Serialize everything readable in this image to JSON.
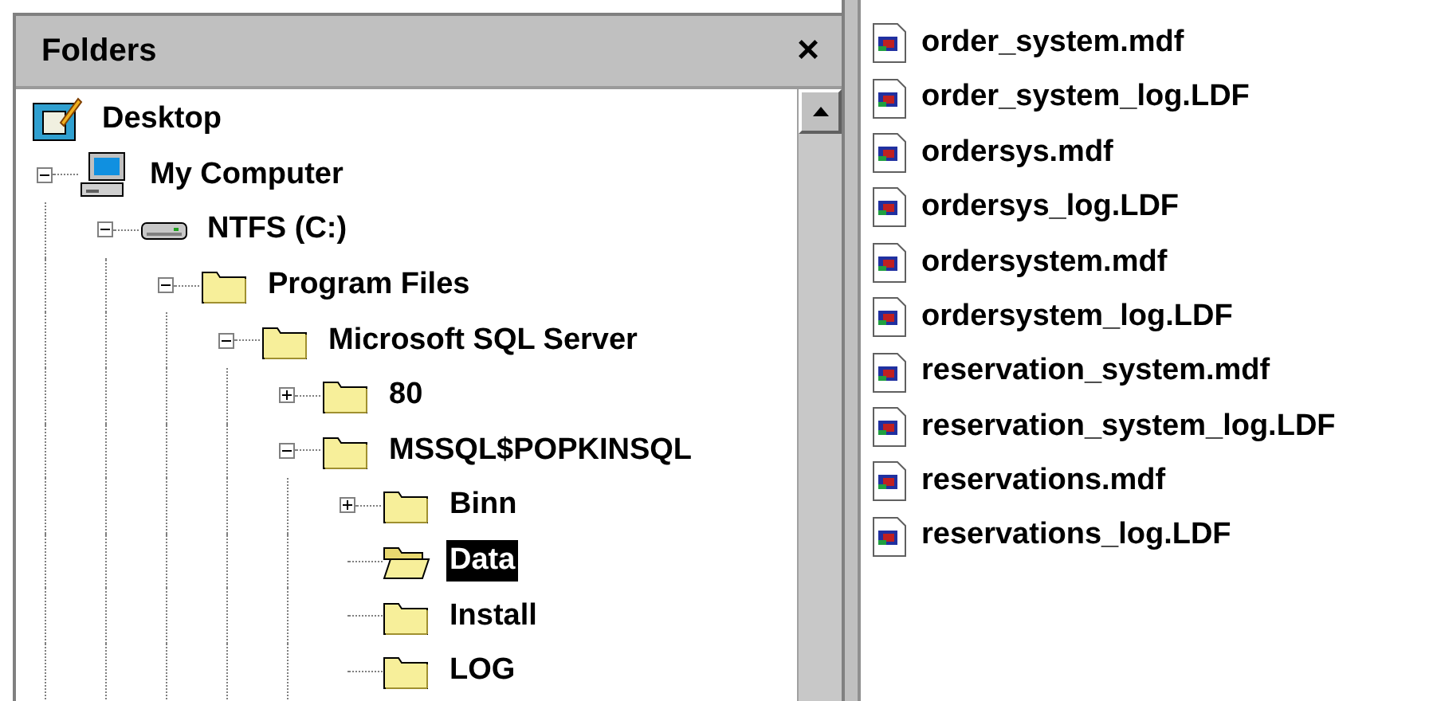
{
  "folders_pane": {
    "title": "Folders",
    "close": "×"
  },
  "tree": [
    {
      "label": "Desktop",
      "kind": "desktop",
      "selected": false,
      "children": [
        {
          "label": "My Computer",
          "kind": "computer",
          "expanded": true,
          "selected": false,
          "children": [
            {
              "label": "NTFS (C:)",
              "kind": "drive",
              "expanded": true,
              "selected": false,
              "children": [
                {
                  "label": "Program Files",
                  "kind": "folder",
                  "expanded": true,
                  "selected": false,
                  "children": [
                    {
                      "label": "Microsoft SQL Server",
                      "kind": "folder",
                      "expanded": true,
                      "selected": false,
                      "children": [
                        {
                          "label": "80",
                          "kind": "folder",
                          "expanded": false,
                          "selected": false
                        },
                        {
                          "label": "MSSQL$POPKINSQL",
                          "kind": "folder",
                          "expanded": true,
                          "selected": false,
                          "children": [
                            {
                              "label": "Binn",
                              "kind": "folder",
                              "expanded": false,
                              "selected": false
                            },
                            {
                              "label": "Data",
                              "kind": "folder",
                              "selected": true
                            },
                            {
                              "label": "Install",
                              "kind": "folder",
                              "selected": false
                            },
                            {
                              "label": "LOG",
                              "kind": "folder",
                              "selected": false
                            }
                          ]
                        }
                      ]
                    }
                  ]
                }
              ]
            }
          ]
        }
      ]
    }
  ],
  "files": [
    {
      "name": "order_system.mdf"
    },
    {
      "name": "order_system_log.LDF"
    },
    {
      "name": "ordersys.mdf"
    },
    {
      "name": "ordersys_log.LDF"
    },
    {
      "name": "ordersystem.mdf"
    },
    {
      "name": "ordersystem_log.LDF"
    },
    {
      "name": "reservation_system.mdf"
    },
    {
      "name": "reservation_system_log.LDF"
    },
    {
      "name": "reservations.mdf"
    },
    {
      "name": "reservations_log.LDF"
    }
  ]
}
